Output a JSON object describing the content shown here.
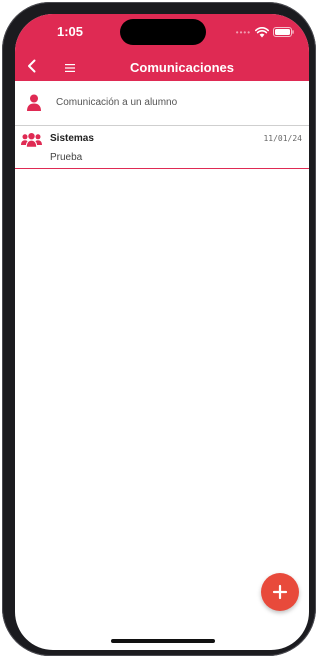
{
  "status_bar": {
    "time": "1:05",
    "signal_dots": "••••"
  },
  "header": {
    "title": "Comunicaciones",
    "back_icon": "chevron-left-icon",
    "menu_icon": "hamburger-menu-icon"
  },
  "compose": {
    "label": "Comunicación a un alumno",
    "icon": "person-icon"
  },
  "messages": [
    {
      "sender": "Sistemas",
      "date": "11/01/24",
      "subject": "Prueba",
      "icon": "group-icon"
    }
  ],
  "fab": {
    "icon": "plus-icon"
  },
  "colors": {
    "primary": "#df2a53",
    "fab": "#e84a3b",
    "divider": "#cfcfcf",
    "device_frame": "#1b1b1f"
  }
}
